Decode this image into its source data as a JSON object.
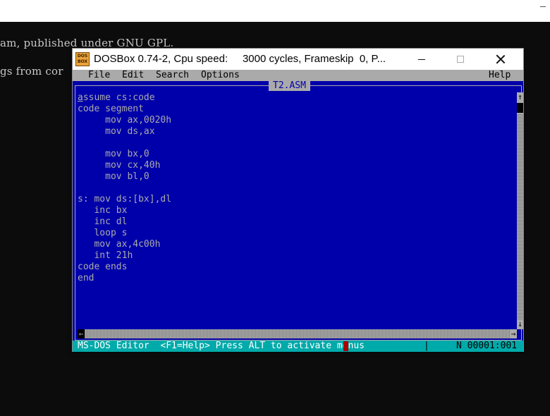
{
  "terminal": {
    "lines": [
      "am, published under GNU GPL.",
      "gs from cor"
    ]
  },
  "dosbox": {
    "title": "DOSBox 0.74-2, Cpu speed:     3000 cycles, Frameskip  0, P...",
    "app_icon_text": "DOS BOX"
  },
  "menu": {
    "file": "File",
    "edit": "Edit",
    "search": "Search",
    "options": "Options",
    "help": "Help"
  },
  "editor": {
    "filename": "T2.ASM",
    "first_char": "a",
    "first_line_rest": "ssume cs:code",
    "lines": [
      "code segment",
      "     mov ax,0020h",
      "     mov ds,ax",
      "",
      "     mov bx,0",
      "     mov cx,40h",
      "     mov bl,0",
      "",
      "s: mov ds:[bx],dl",
      "   inc bx",
      "   inc dl",
      "   loop s",
      "   mov ax,4c00h",
      "   int 21h",
      "code ends",
      "end"
    ]
  },
  "status": {
    "left": "MS-DOS Editor  <F1=Help> Press ALT to activate menus",
    "divider": "|",
    "position": "N 00001:001"
  },
  "colors": {
    "dos_blue": "#0000aa",
    "dos_gray": "#aaaaaa",
    "status_cyan": "#00aaaa"
  }
}
